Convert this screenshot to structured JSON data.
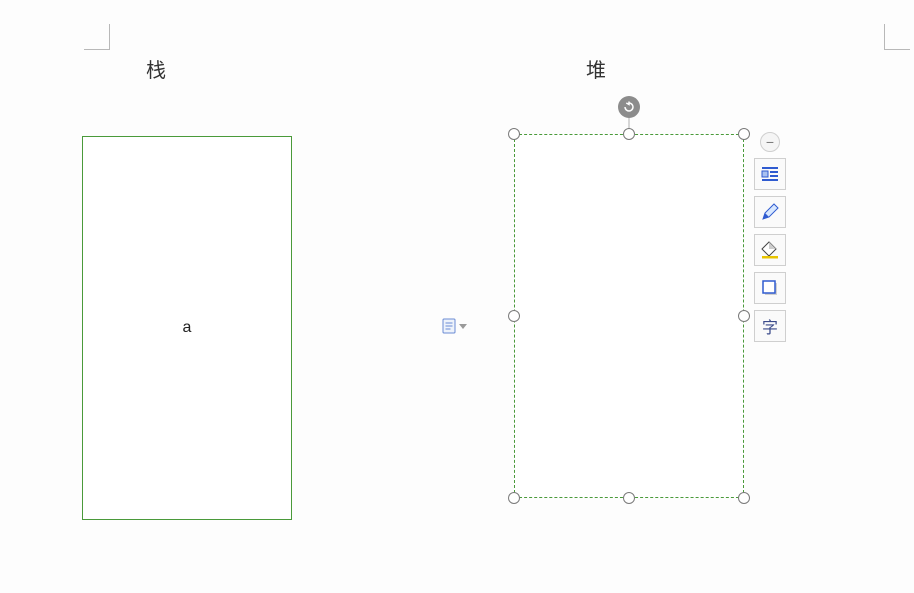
{
  "labels": {
    "stack": "栈",
    "heap": "堆"
  },
  "shapes": {
    "left_rect_text": "a"
  },
  "toolbar": {
    "collapse_glyph": "−",
    "text_insert_char": "字"
  },
  "colors": {
    "shape_border": "#4a9a3a",
    "handle_fill": "#ffffff",
    "handle_stroke": "#7a7a7a",
    "toolbar_border": "#cfcfcf",
    "accent_blue": "#2f5bd0",
    "accent_yellow": "#e8c400"
  }
}
